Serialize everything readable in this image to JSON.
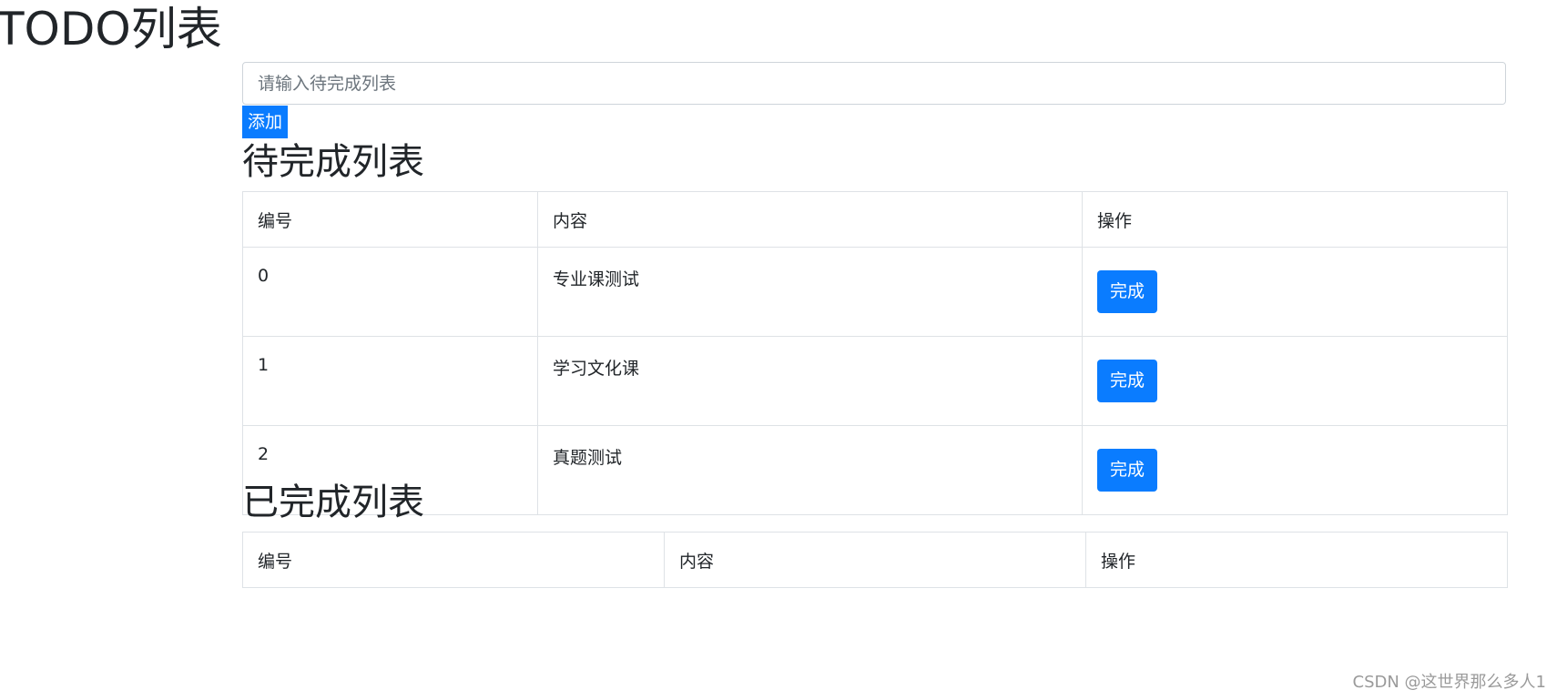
{
  "header": {
    "title": "TODO列表"
  },
  "input": {
    "placeholder": "请输入待完成列表",
    "value": ""
  },
  "add_button": {
    "label": "添加"
  },
  "pending": {
    "heading": "待完成列表",
    "columns": [
      "编号",
      "内容",
      "操作"
    ],
    "rows": [
      {
        "id": "0",
        "content": "专业课测试",
        "action": "完成"
      },
      {
        "id": "1",
        "content": "学习文化课",
        "action": "完成"
      },
      {
        "id": "2",
        "content": "真题测试",
        "action": "完成"
      }
    ]
  },
  "completed": {
    "heading": "已完成列表",
    "columns": [
      "编号",
      "内容",
      "操作"
    ],
    "rows": []
  },
  "watermark": "CSDN @这世界那么多人1",
  "colors": {
    "primary": "#0a7cff",
    "border": "#dee2e6",
    "text": "#212529"
  }
}
